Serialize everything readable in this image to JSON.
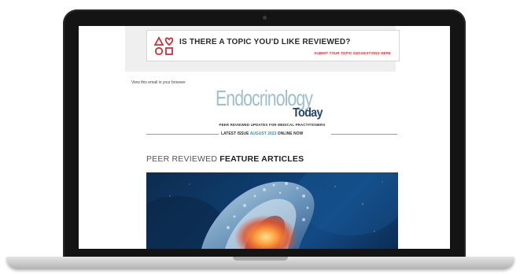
{
  "suggestion_banner": {
    "title": "IS THERE A TOPIC YOU'D LIKE REVIEWED?",
    "link": "SUBMIT YOUR TOPIC SUGGESTIONS HERE",
    "icon": "shapes-icon",
    "accent_color": "#c8323a"
  },
  "header": {
    "view_in_browser": "View this email in your browser",
    "logo_main": "Endocrinology",
    "logo_sub": "Today",
    "tagline": "PEER REVIEWED UPDATES FOR MEDICAL PRACTITIONERS"
  },
  "issue": {
    "prefix": "LATEST ISSUE",
    "month": "AUGUST 2023",
    "suffix": "ONLINE NOW"
  },
  "section": {
    "light": "PEER REVIEWED",
    "bold": "FEATURE ARTICLES"
  },
  "feature_image": {
    "description_icon": "thyroid-illustration"
  }
}
